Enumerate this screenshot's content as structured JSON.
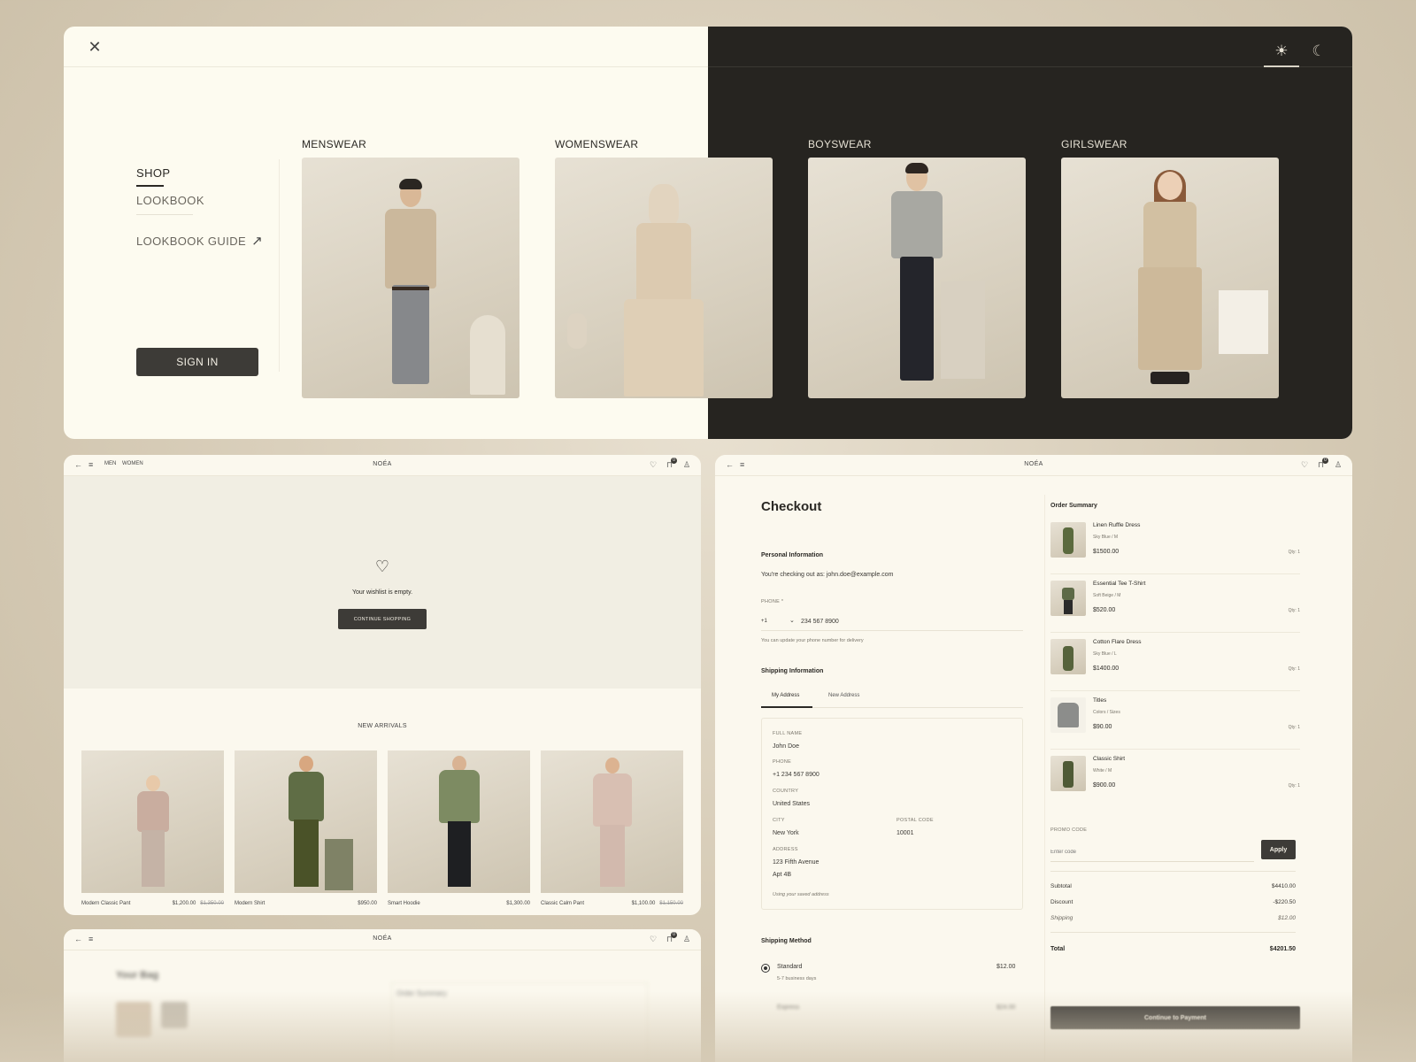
{
  "menu": {
    "nav": {
      "shop": "SHOP",
      "lookbook": "LOOKBOOK",
      "lookbook_guide": "LOOKBOOK GUIDE"
    },
    "sign_in": "SIGN IN",
    "categories": [
      "MENSWEAR",
      "WOMENSWEAR",
      "BOYSWEAR",
      "GIRLSWEAR"
    ],
    "icons": {
      "close": "close-icon",
      "light": "sun-icon",
      "dark": "moon-icon"
    },
    "colors": {
      "light_bg": "#fdfbf0",
      "dark_bg": "#262420"
    }
  },
  "wishlist": {
    "topbar": {
      "links": [
        "MEN",
        "WOMEN"
      ],
      "brand": "NOÉA",
      "cart_count": "0"
    },
    "empty_message": "Your wishlist is empty.",
    "continue_button": "CONTINUE SHOPPING",
    "new_arrivals_title": "NEW ARRIVALS",
    "products": [
      {
        "name": "Modern Classic Pant",
        "price": "$1,200.00",
        "old_price": "$1,350.00"
      },
      {
        "name": "Modern Shirt",
        "price": "$950.00",
        "old_price": ""
      },
      {
        "name": "Smart Hoodie",
        "price": "$1,300.00",
        "old_price": ""
      },
      {
        "name": "Classic Calm Pant",
        "price": "$1,100.00",
        "old_price": "$1,150.00"
      }
    ]
  },
  "bag": {
    "topbar": {
      "brand": "NOÉA",
      "cart_count": "0"
    },
    "title": "Your Bag",
    "summary_title": "Order Summary"
  },
  "checkout": {
    "topbar": {
      "brand": "NOÉA",
      "cart_count": "0"
    },
    "title": "Checkout",
    "personal": {
      "heading": "Personal Information",
      "checking_out_as": "You're checking out as: john.doe@example.com",
      "phone_label": "PHONE *",
      "country_code": "+1",
      "phone_value": "234 567 8900",
      "phone_hint": "You can update your phone number for delivery"
    },
    "shipping_info": {
      "heading": "Shipping Information",
      "tabs": [
        "My Address",
        "New Address"
      ],
      "full_name_label": "FULL NAME",
      "full_name": "John Doe",
      "phone_label": "PHONE",
      "phone": "+1 234 567 8900",
      "country_label": "COUNTRY",
      "country": "United States",
      "city_label": "CITY",
      "city": "New York",
      "postal_label": "POSTAL CODE",
      "postal": "10001",
      "address_label": "ADDRESS",
      "address_line1": "123 Fifth Avenue",
      "address_line2": "Apt 4B",
      "saved_note": "Using your saved address"
    },
    "shipping_method": {
      "heading": "Shipping Method",
      "options": [
        {
          "name": "Standard",
          "detail": "5-7 business days",
          "price": "$12.00",
          "selected": true
        },
        {
          "name": "Express",
          "detail": "",
          "price": "$24.00",
          "selected": false
        }
      ]
    },
    "summary": {
      "title": "Order Summary",
      "items": [
        {
          "name": "Linen Ruffle Dress",
          "variant": "Sky Blue / M",
          "price": "$1500.00",
          "qty": "Qty: 1"
        },
        {
          "name": "Essential Tee T-Shirt",
          "variant": "Soft Beige / M",
          "price": "$520.00",
          "qty": "Qty: 1"
        },
        {
          "name": "Cotton Flare Dress",
          "variant": "Sky Blue / L",
          "price": "$1400.00",
          "qty": "Qty: 1"
        },
        {
          "name": "Titles",
          "variant": "Colors / Sizes",
          "price": "$90.00",
          "qty": "Qty: 1"
        },
        {
          "name": "Classic Shirt",
          "variant": "White / M",
          "price": "$900.00",
          "qty": "Qty: 1"
        }
      ],
      "promo_label": "PROMO CODE",
      "promo_placeholder": "Enter code",
      "apply": "Apply",
      "subtotal_label": "Subtotal",
      "subtotal": "$4410.00",
      "discount_label": "Discount",
      "discount": "-$220.50",
      "shipping_label": "Shipping",
      "shipping": "$12.00",
      "total_label": "Total",
      "total": "$4201.50",
      "continue": "Continue to Payment"
    }
  }
}
